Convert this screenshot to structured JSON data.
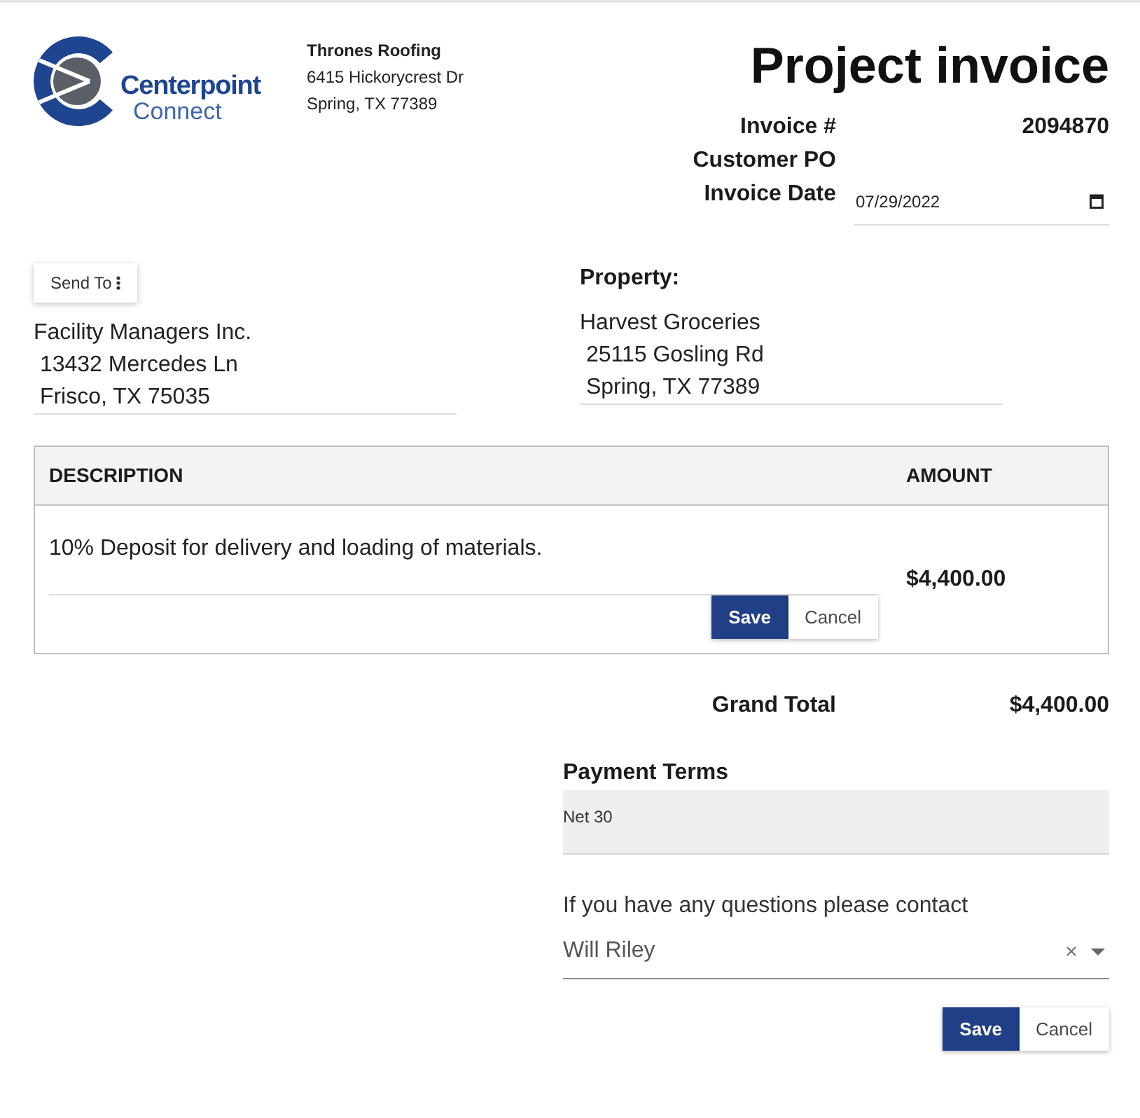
{
  "logo": {
    "name_line_1": "Centerpoint",
    "name_line_2": "Connect"
  },
  "company": {
    "name": "Thrones Roofing",
    "address_lines": [
      "6415 Hickorycrest Dr",
      "Spring, TX 77389"
    ]
  },
  "title": "Project invoice",
  "invoice_fields": [
    {
      "label": "Invoice #",
      "value": "2094870",
      "kind": "text"
    },
    {
      "label": "Customer PO",
      "kind": "text"
    },
    {
      "label": "Invoice Date",
      "value": "07/29/2022",
      "kind": "date"
    }
  ],
  "send_to": {
    "button": "Send To",
    "address_lines": [
      "Facility Managers Inc.",
      " 13432 Mercedes Ln",
      " Frisco, TX 75035"
    ]
  },
  "property": {
    "label": "Property:",
    "address_lines": [
      "Harvest Groceries",
      " 25115 Gosling Rd",
      " Spring, TX 77389"
    ]
  },
  "table": {
    "columns": [
      "DESCRIPTION",
      "AMOUNT"
    ],
    "rows": [
      {
        "description": "10% Deposit for delivery and loading of materials.",
        "amount": "$4,400.00",
        "actions": [
          {
            "label": "Save",
            "kind": "primary"
          },
          {
            "label": "Cancel",
            "kind": "secondary"
          }
        ]
      }
    ]
  },
  "grand_total": {
    "label": "Grand Total",
    "value": "$4,400.00"
  },
  "payment_terms": {
    "label": "Payment Terms",
    "value": "Net 30"
  },
  "contact": {
    "label": "If you have any questions please contact",
    "value": "Will Riley"
  },
  "actions": [
    {
      "label": "Save",
      "kind": "primary"
    },
    {
      "label": "Cancel",
      "kind": "secondary"
    }
  ]
}
